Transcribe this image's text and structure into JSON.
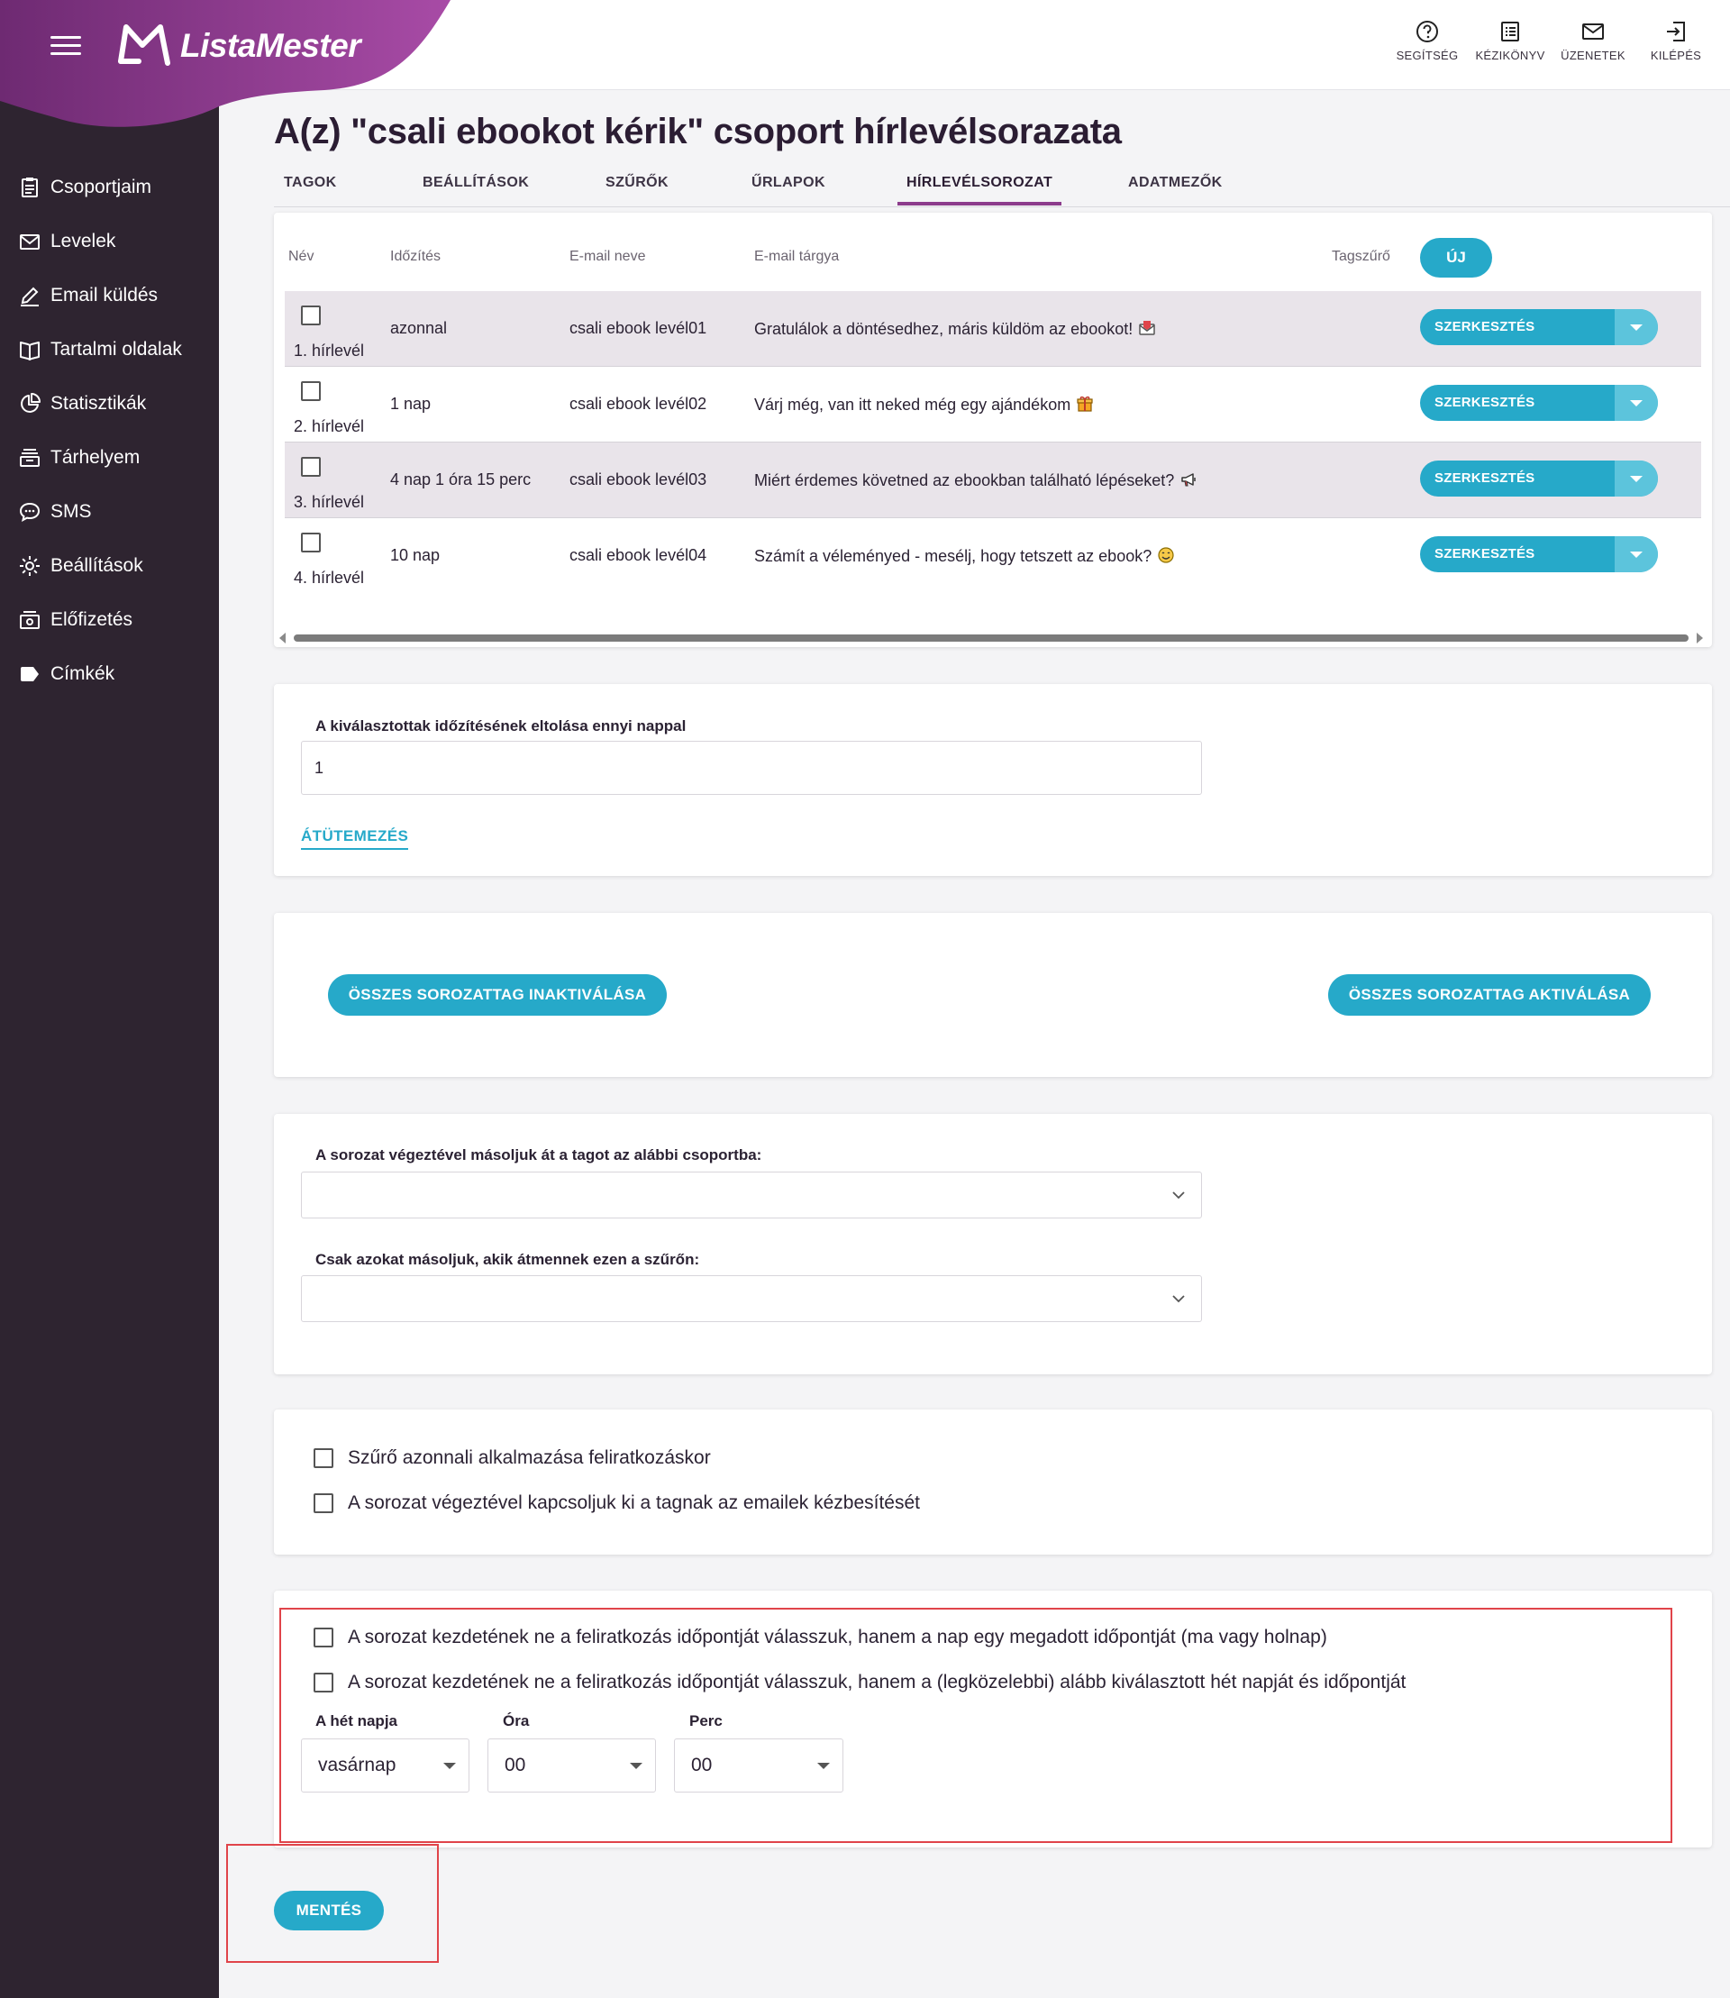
{
  "app": {
    "brand": "ListaMester",
    "accent_color": "#26a9c9",
    "sidebar_color": "#2e2430",
    "brand_gradient": [
      "#7b2f7d",
      "#a54aa3"
    ]
  },
  "top_actions": [
    {
      "icon": "help-circle-icon",
      "label": "SEGÍTSÉG"
    },
    {
      "icon": "manual-icon",
      "label": "KÉZIKÖNYV"
    },
    {
      "icon": "mail-icon",
      "label": "ÜZENETEK"
    },
    {
      "icon": "logout-icon",
      "label": "KILÉPÉS"
    }
  ],
  "sidebar": {
    "items": [
      {
        "icon": "clipboard-icon",
        "label": "Csoportjaim"
      },
      {
        "icon": "envelope-icon",
        "label": "Levelek"
      },
      {
        "icon": "pencil-icon",
        "label": "Email küldés"
      },
      {
        "icon": "book-icon",
        "label": "Tartalmi oldalak"
      },
      {
        "icon": "pie-chart-icon",
        "label": "Statisztikák"
      },
      {
        "icon": "storage-icon",
        "label": "Tárhelyem"
      },
      {
        "icon": "chat-bubble-icon",
        "label": "SMS"
      },
      {
        "icon": "gear-icon",
        "label": "Beállítások"
      },
      {
        "icon": "subscription-icon",
        "label": "Előfizetés"
      },
      {
        "icon": "tag-icon",
        "label": "Címkék"
      }
    ]
  },
  "page": {
    "title": "A(z) \"csali ebookot kérik\" csoport hírlevélsorazata"
  },
  "tabs": [
    {
      "label": "TAGOK",
      "active": false
    },
    {
      "label": "BEÁLLÍTÁSOK",
      "active": false
    },
    {
      "label": "SZŰRŐK",
      "active": false
    },
    {
      "label": "ŰRLAPOK",
      "active": false
    },
    {
      "label": "HÍRLEVÉLSOROZAT",
      "active": true
    },
    {
      "label": "ADATMEZŐK",
      "active": false
    }
  ],
  "table": {
    "headers": {
      "name": "Név",
      "timing": "Időzítés",
      "email_name": "E-mail neve",
      "email_subject": "E-mail tárgya",
      "member_filter": "Tagszűrő"
    },
    "new_button": "ÚJ",
    "edit_label": "SZERKESZTÉS",
    "rows": [
      {
        "name": "1. hírlevél",
        "timing": "azonnal",
        "email_name": "csali ebook levél01",
        "subject": "Gratulálok a döntésedhez, máris küldöm az ebookot!",
        "emoji": "envelope-emoji-icon"
      },
      {
        "name": "2. hírlevél",
        "timing": "1 nap",
        "email_name": "csali ebook levél02",
        "subject": "Várj még, van itt neked még egy ajándékom",
        "emoji": "gift-emoji-icon"
      },
      {
        "name": "3. hírlevél",
        "timing": "4 nap 1 óra 15 perc",
        "email_name": "csali ebook levél03",
        "subject": "Miért érdemes követned az ebookban található lépéseket?",
        "emoji": "megaphone-emoji-icon"
      },
      {
        "name": "4. hírlevél",
        "timing": "10 nap",
        "email_name": "csali ebook levél04",
        "subject": "Számít a véleményed - mesélj, hogy tetszett az ebook?",
        "emoji": "smile-emoji-icon"
      }
    ]
  },
  "reschedule": {
    "label": "A kiválasztottak időzítésének eltolása ennyi nappal",
    "value": "1",
    "button": "ÁTÜTEMEZÉS"
  },
  "bulk": {
    "deactivate": "ÖSSZES SOROZATTAG INAKTIVÁLÁSA",
    "activate": "ÖSSZES SOROZATTAG AKTIVÁLÁSA"
  },
  "copy": {
    "group_label": "A sorozat végeztével másoljuk át a tagot az alábbi csoportba:",
    "group_value": "",
    "filter_label": "Csak azokat másoljuk, akik átmennek ezen a szűrőn:",
    "filter_value": ""
  },
  "options": {
    "filter_on_subscribe": "Szűrő azonnali alkalmazása feliratkozáskor",
    "disable_delivery": "A sorozat végeztével kapcsoljuk ki a tagnak az emailek kézbesítését"
  },
  "start": {
    "option_date": "A sorozat kezdetének ne a feliratkozás időpontját válasszuk, hanem a nap egy megadott időpontját (ma vagy holnap)",
    "option_weekday": "A sorozat kezdetének ne a feliratkozás időpontját válasszuk, hanem a (legközelebbi) alább kiválasztott hét napját és időpontját",
    "weekday_label": "A hét napja",
    "hour_label": "Óra",
    "minute_label": "Perc",
    "weekday_value": "vasárnap",
    "hour_value": "00",
    "minute_value": "00"
  },
  "save_button": "MENTÉS"
}
